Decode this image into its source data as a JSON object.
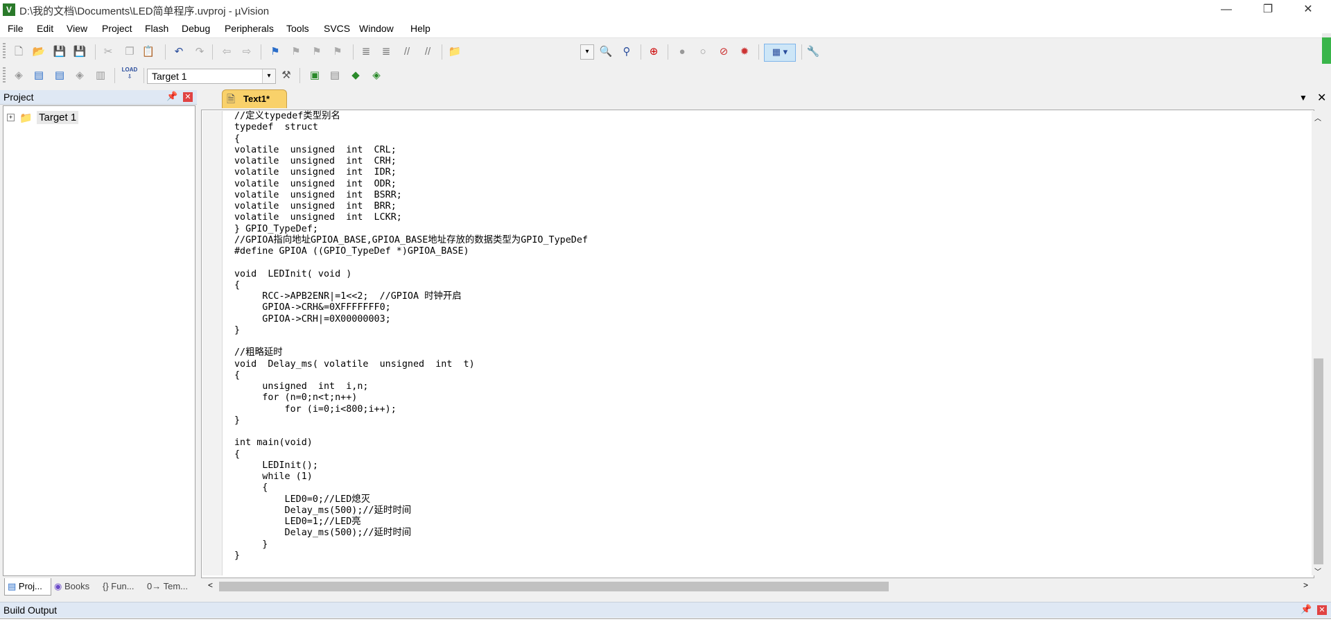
{
  "window": {
    "title": "D:\\我的文档\\Documents\\LED简单程序.uvproj - µVision",
    "app_icon": "V",
    "minimize": "—",
    "restore": "❐",
    "close": "✕"
  },
  "menu": [
    "File",
    "Edit",
    "View",
    "Project",
    "Flash",
    "Debug",
    "Peripherals",
    "Tools",
    "SVCS",
    "Window",
    "Help"
  ],
  "toolbar": {
    "target": "Target 1",
    "load_label": "LOAD"
  },
  "project": {
    "title": "Project",
    "tree": [
      {
        "label": "Target 1",
        "expand": "+"
      }
    ],
    "tabs": [
      "Proj...",
      "Books",
      "{} Fun...",
      "0→ Tem..."
    ]
  },
  "editor": {
    "tab": "Text1*",
    "lines": [
      "//定义typedef类型别名",
      "typedef  struct",
      "{",
      "volatile  unsigned  int  CRL;",
      "volatile  unsigned  int  CRH;",
      "volatile  unsigned  int  IDR;",
      "volatile  unsigned  int  ODR;",
      "volatile  unsigned  int  BSRR;",
      "volatile  unsigned  int  BRR;",
      "volatile  unsigned  int  LCKR;",
      "} GPIO_TypeDef;",
      "//GPIOA指向地址GPIOA_BASE,GPIOA_BASE地址存放的数据类型为GPIO_TypeDef",
      "#define GPIOA ((GPIO_TypeDef *)GPIOA_BASE)",
      "",
      "void  LEDInit( void )",
      "{",
      "     RCC->APB2ENR|=1<<2;  //GPIOA 时钟开启",
      "     GPIOA->CRH&=0XFFFFFFF0;",
      "     GPIOA->CRH|=0X00000003;",
      "}",
      "",
      "//粗略延时",
      "void  Delay_ms( volatile  unsigned  int  t)",
      "{",
      "     unsigned  int  i,n;",
      "     for (n=0;n<t;n++)",
      "         for (i=0;i<800;i++);",
      "}",
      "",
      "int main(void)",
      "{",
      "     LEDInit();",
      "     while (1)",
      "     {",
      "         LED0=0;//LED熄灭",
      "         Delay_ms(500);//延时时间",
      "         LED0=1;//LED亮",
      "         Delay_ms(500);//延时时间",
      "     }",
      "}"
    ]
  },
  "build_output": {
    "title": "Build Output"
  }
}
